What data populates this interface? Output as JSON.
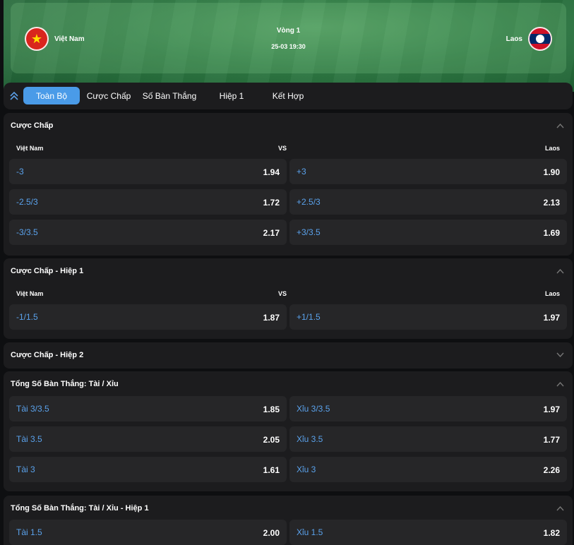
{
  "match": {
    "home": "Việt Nam",
    "away": "Laos",
    "round": "Vòng 1",
    "datetime": "25-03 19:30"
  },
  "tabs": [
    "Toàn Bộ",
    "Cược Chấp",
    "Số Bàn Thắng",
    "Hiệp 1",
    "Kết Hợp"
  ],
  "vs_label": "VS",
  "markets": {
    "handicap": {
      "title": "Cược Chấp",
      "rows": [
        {
          "left_label": "-3",
          "left_odd": "1.94",
          "right_label": "+3",
          "right_odd": "1.90"
        },
        {
          "left_label": "-2.5/3",
          "left_odd": "1.72",
          "right_label": "+2.5/3",
          "right_odd": "2.13"
        },
        {
          "left_label": "-3/3.5",
          "left_odd": "2.17",
          "right_label": "+3/3.5",
          "right_odd": "1.69"
        }
      ]
    },
    "handicap_h1": {
      "title": "Cược Chấp - Hiệp 1",
      "rows": [
        {
          "left_label": "-1/1.5",
          "left_odd": "1.87",
          "right_label": "+1/1.5",
          "right_odd": "1.97"
        }
      ]
    },
    "handicap_h2": {
      "title": "Cược Chấp - Hiệp 2"
    },
    "total": {
      "title": "Tổng Số Bàn Thắng: Tài / Xỉu",
      "rows": [
        {
          "left_label": "Tài 3/3.5",
          "left_odd": "1.85",
          "right_label": "Xỉu 3/3.5",
          "right_odd": "1.97"
        },
        {
          "left_label": "Tài 3.5",
          "left_odd": "2.05",
          "right_label": "Xỉu 3.5",
          "right_odd": "1.77"
        },
        {
          "left_label": "Tài 3",
          "left_odd": "1.61",
          "right_label": "Xỉu 3",
          "right_odd": "2.26"
        }
      ]
    },
    "total_h1": {
      "title": "Tổng Số Bàn Thắng: Tài / Xỉu - Hiệp 1",
      "rows": [
        {
          "left_label": "Tài 1.5",
          "left_odd": "2.00",
          "right_label": "Xỉu 1.5",
          "right_odd": "1.82"
        }
      ]
    }
  },
  "colors": {
    "accent": "#4a9be8",
    "odd_label": "#5aa2ec",
    "panel": "#1c1c1e",
    "cell": "#262628"
  }
}
